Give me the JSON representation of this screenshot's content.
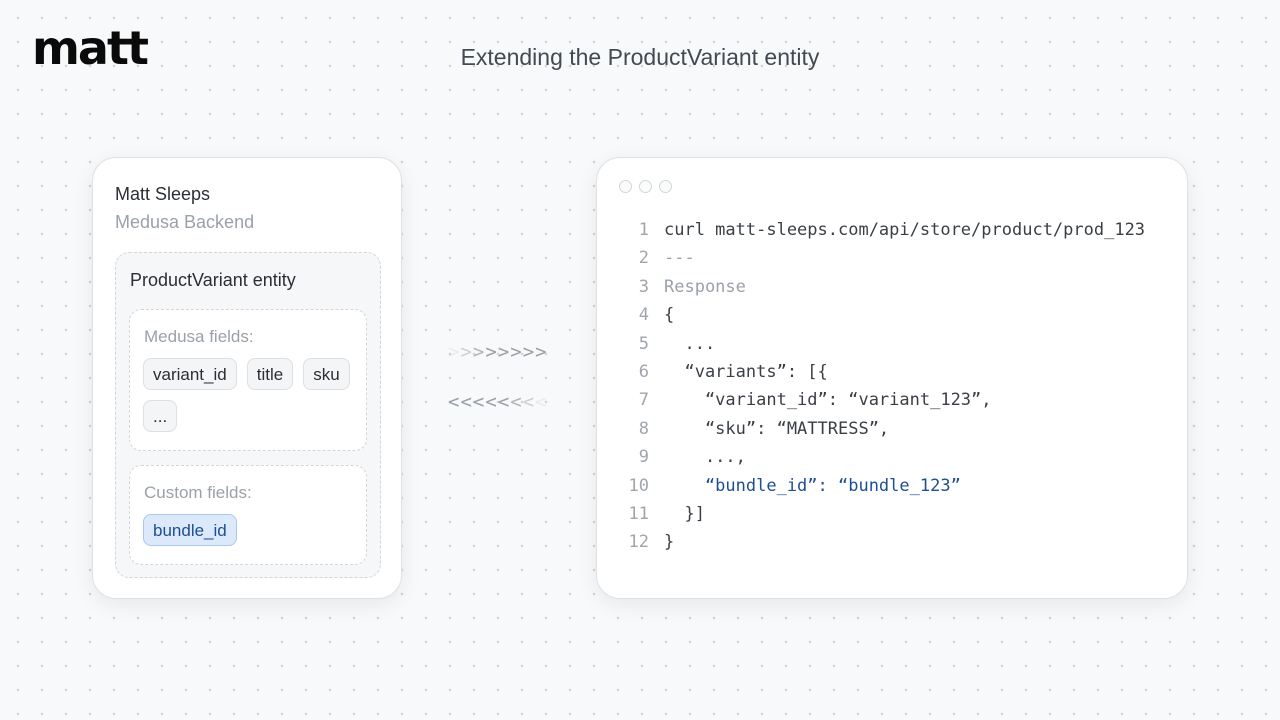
{
  "brand": {
    "logo_text": "matt"
  },
  "page": {
    "title": "Extending the ProductVariant entity"
  },
  "backend_card": {
    "store_name": "Matt Sleeps",
    "subtitle": "Medusa Backend",
    "entity": {
      "title": "ProductVariant entity",
      "medusa_fields": {
        "label": "Medusa fields:",
        "chips": [
          "variant_id",
          "title",
          "sku",
          "..."
        ]
      },
      "custom_fields": {
        "label": "Custom fields:",
        "chips": [
          "bundle_id"
        ]
      }
    }
  },
  "arrows": {
    "request": ">>>>>>>>",
    "response": "<<<<<<<<"
  },
  "code_window": {
    "lines": [
      {
        "num": "1",
        "text": "curl matt-sleeps.com/api/store/product/prod_123",
        "style": "normal"
      },
      {
        "num": "2",
        "text": "---",
        "style": "muted"
      },
      {
        "num": "3",
        "text": "Response",
        "style": "muted"
      },
      {
        "num": "4",
        "text": "{",
        "style": "normal"
      },
      {
        "num": "5",
        "text": "  ...",
        "style": "normal"
      },
      {
        "num": "6",
        "text": "  “variants”: [{",
        "style": "normal"
      },
      {
        "num": "7",
        "text": "    “variant_id”: “variant_123”,",
        "style": "normal"
      },
      {
        "num": "8",
        "text": "    “sku”: “MATTRESS”,",
        "style": "normal"
      },
      {
        "num": "9",
        "text": "    ...,",
        "style": "normal"
      },
      {
        "num": "10",
        "text": "    “bundle_id”: “bundle_123”",
        "style": "highlight"
      },
      {
        "num": "11",
        "text": "  }]",
        "style": "normal"
      },
      {
        "num": "12",
        "text": "}",
        "style": "normal"
      }
    ]
  },
  "colors": {
    "accent": "#1f4f93",
    "chip_custom_bg": "#dbe9fb",
    "arrow": "#9aa0a8"
  }
}
